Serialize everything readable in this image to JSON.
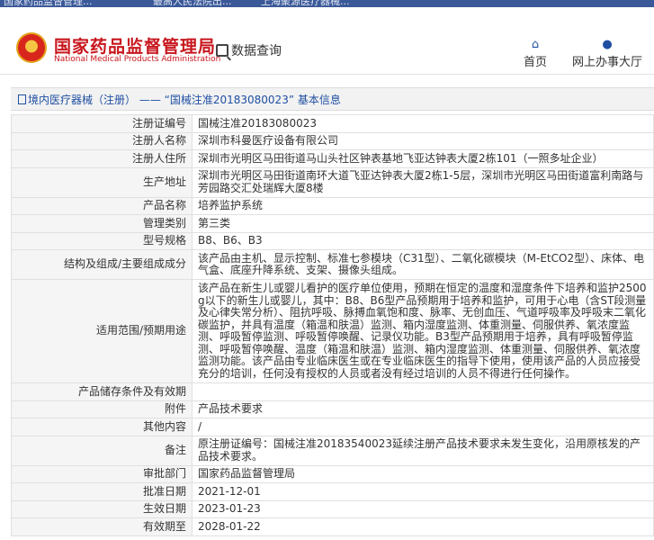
{
  "browser_tabs": [
    "国家药品监督管理...",
    "最高人民法院出...",
    "上海聚源医疗器械..."
  ],
  "site": {
    "title_cn": "国家药品监督管理局",
    "title_en": "National Medical Products Administration",
    "query_label": "数据查询"
  },
  "nav": [
    {
      "icon": "home-icon",
      "label": "首页"
    },
    {
      "icon": "user-icon",
      "label": "网上办事大厅"
    }
  ],
  "breadcrumb": "境内医疗器械（注册） —— “国械注准20183080023” 基本信息",
  "colors": {
    "brand_red": "#c8161d",
    "link_blue": "#1f4fa3",
    "label_bg": "#f5f5f5"
  },
  "rows": [
    {
      "label": "注册证编号",
      "value": "国械注准20183080023"
    },
    {
      "label": "注册人名称",
      "value": "深圳市科曼医疗设备有限公司"
    },
    {
      "label": "注册人住所",
      "value": "深圳市光明区马田街道马山头社区钟表基地飞亚达钟表大厦2栋101（一照多址企业）"
    },
    {
      "label": "生产地址",
      "value": "深圳市光明区马田街道南环大道飞亚达钟表大厦2栋1-5层，深圳市光明区马田街道富利南路与芳园路交汇处瑞辉大厦8楼"
    },
    {
      "label": "产品名称",
      "value": "培养监护系统"
    },
    {
      "label": "管理类别",
      "value": "第三类"
    },
    {
      "label": "型号规格",
      "value": "B8、B6、B3"
    },
    {
      "label": "结构及组成/主要组成成分",
      "value": "该产品由主机、显示控制、标准七参模块（C31型）、二氧化碳模块（M-EtCO2型）、床体、电气盒、底座升降系统、支架、摄像头组成。"
    },
    {
      "label": "适用范围/预期用途",
      "value": "该产品在新生儿或婴儿看护的医疗单位使用，预期在恒定的温度和湿度条件下培养和监护2500g以下的新生儿或婴儿，其中：B8、B6型产品预期用于培养和监护，可用于心电（含ST段测量及心律失常分析）、阻抗呼吸、脉搏血氧饱和度、脉率、无创血压、气道呼吸率及呼吸末二氧化碳监护，并具有温度（箱温和肤温）监测、箱内湿度监测、体重测量、伺服供养、氧浓度监测、呼吸暂停监测、呼吸暂停唤醒、记录仪功能。B3型产品预期用于培养，具有呼吸暂停监测、呼吸暂停唤醒、温度（箱温和肤温）监测、箱内湿度监测、体重测量、伺服供养、氧浓度监测功能。该产品由专业临床医生或在专业临床医生的指导下使用，使用该产品的人员应接受充分的培训，任何没有授权的人员或者没有经过培训的人员不得进行任何操作。"
    },
    {
      "label": "产品储存条件及有效期",
      "value": ""
    },
    {
      "label": "附件",
      "value": "产品技术要求"
    },
    {
      "label": "其他内容",
      "value": "/"
    },
    {
      "label": "备注",
      "value": "原注册证编号：国械注准20183540023延续注册产品技术要求未发生变化，沿用原核发的产品技术要求。"
    },
    {
      "label": "审批部门",
      "value": "国家药品监督管理局"
    },
    {
      "label": "批准日期",
      "value": "2021-12-01"
    },
    {
      "label": "生效日期",
      "value": "2023-01-23"
    },
    {
      "label": "有效期至",
      "value": "2028-01-22"
    }
  ]
}
